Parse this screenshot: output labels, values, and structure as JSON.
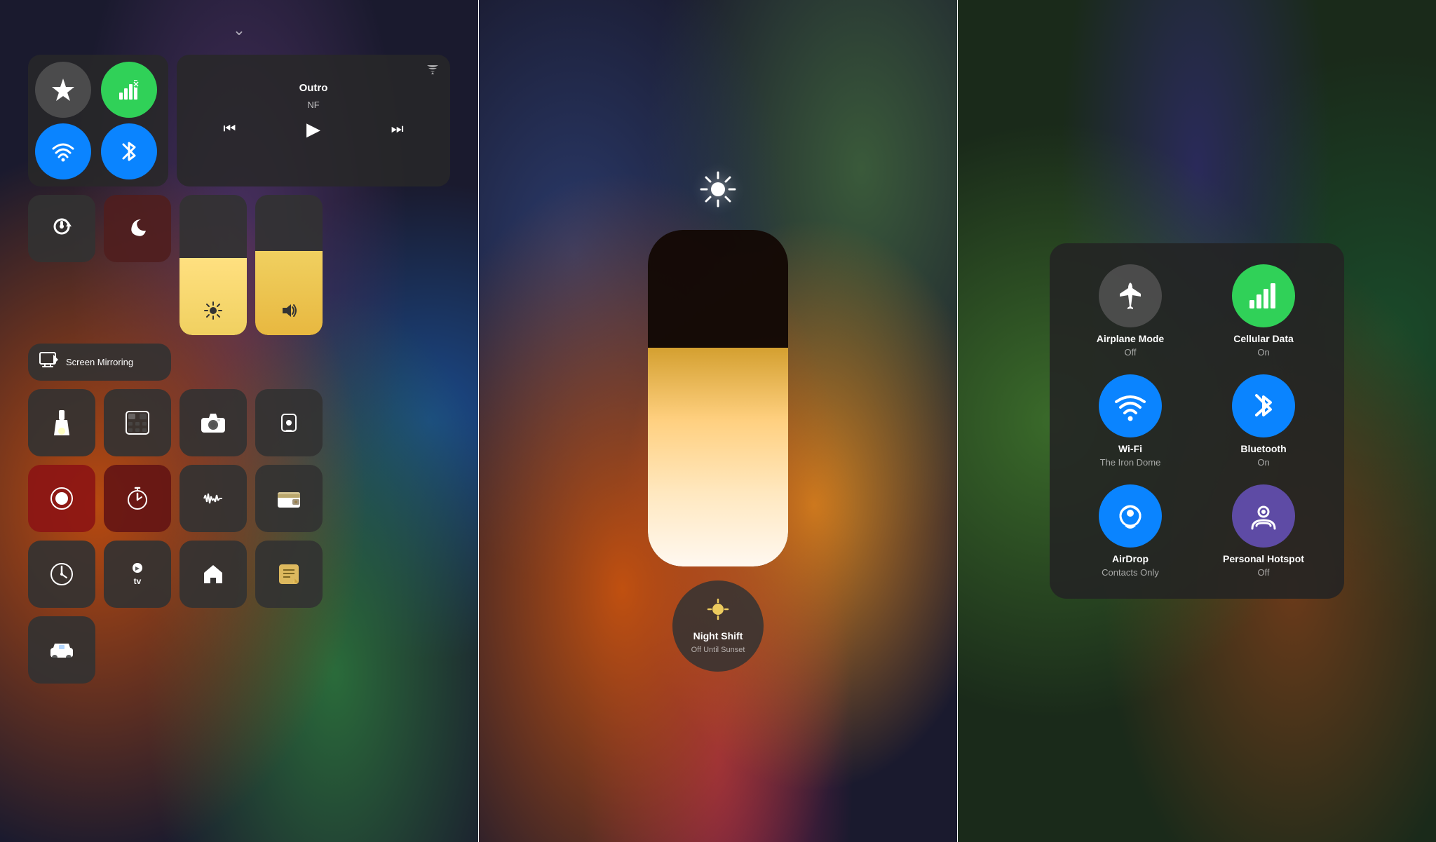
{
  "panels": {
    "left": {
      "chevron": "⌄",
      "connectivity": {
        "airplane": {
          "icon": "✈",
          "active": false
        },
        "cellular": {
          "icon": "📶",
          "active": true
        },
        "wifi": {
          "icon": "WiFi",
          "active": true
        },
        "bluetooth": {
          "icon": "BT",
          "active": true
        }
      },
      "media": {
        "wifi_icon": "📡",
        "title": "Outro",
        "artist": "NF",
        "rewind": "⏮",
        "play": "▶",
        "forward": "⏭"
      },
      "rotation_lock": {
        "icon": "🔒",
        "label": ""
      },
      "do_not_disturb": {
        "icon": "🌙",
        "label": ""
      },
      "screen_mirror": {
        "icon": "📺",
        "label": "Screen Mirroring"
      },
      "brightness": {
        "icon": "☀"
      },
      "volume": {
        "icon": "🔊"
      },
      "buttons": [
        {
          "icon": "🔦",
          "style": "dark"
        },
        {
          "icon": "🖩",
          "style": "dark"
        },
        {
          "icon": "📷",
          "style": "dark"
        },
        {
          "icon": "🔋",
          "style": "dark"
        },
        {
          "icon": "⏺",
          "style": "red"
        },
        {
          "icon": "⏱",
          "style": "darkred"
        },
        {
          "icon": "🎙",
          "style": "dark"
        },
        {
          "icon": "💳",
          "style": "dark"
        },
        {
          "icon": "⏰",
          "style": "dark"
        },
        {
          "icon": "📺",
          "style": "dark"
        },
        {
          "icon": "🏠",
          "style": "dark"
        },
        {
          "icon": "✏",
          "style": "dark"
        }
      ]
    },
    "mid": {
      "sun_top": "☀",
      "pill_label": "",
      "night_shift": {
        "icon": "☀",
        "label": "Night Shift",
        "sub": "Off Until Sunset"
      }
    },
    "right": {
      "network_items": [
        {
          "icon": "✈",
          "style": "gray",
          "label": "Airplane Mode",
          "sub": "Off"
        },
        {
          "icon": "📶",
          "style": "green",
          "label": "Cellular Data",
          "sub": "On"
        },
        {
          "icon": "wifi",
          "style": "blue",
          "label": "Wi-Fi",
          "sub": "The Iron Dome"
        },
        {
          "icon": "bt",
          "style": "blue",
          "label": "Bluetooth",
          "sub": "On"
        },
        {
          "icon": "airdrop",
          "style": "blue",
          "label": "AirDrop",
          "sub": "Contacts Only"
        },
        {
          "icon": "hotspot",
          "style": "purple",
          "label": "Personal Hotspot",
          "sub": "Off"
        }
      ]
    }
  }
}
